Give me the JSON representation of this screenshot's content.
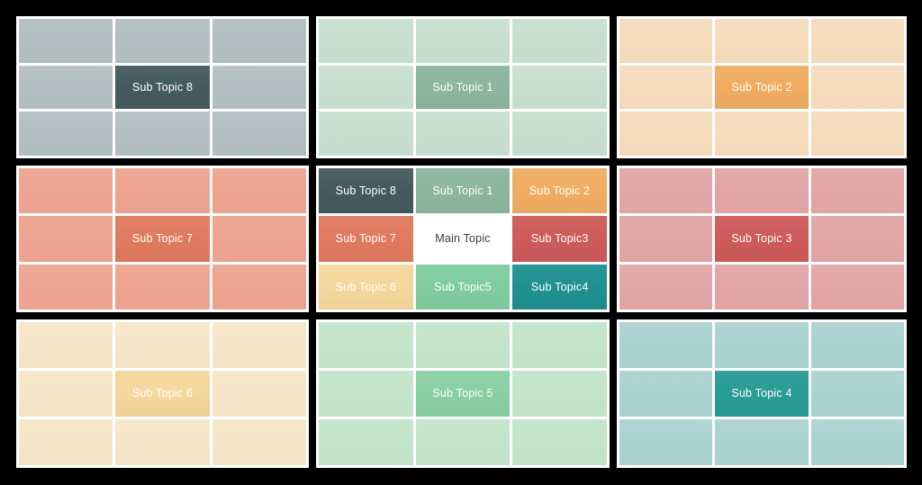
{
  "diagram": {
    "type": "mandala-chart",
    "title": "Main Topic",
    "background_color": "#000000",
    "gridline_color": "#ffffff",
    "main_topic_text_color": "#3b3b3b",
    "sub_topic_text_color": "#ffffff"
  },
  "center_block": {
    "name": "center-block",
    "cells": [
      {
        "label": "Sub Topic 8",
        "color": "#455a5f",
        "role": "core"
      },
      {
        "label": "Sub Topic 1",
        "color": "#8cb69d",
        "role": "core"
      },
      {
        "label": "Sub Topic 2",
        "color": "#f0ad62",
        "role": "core"
      },
      {
        "label": "Sub Topic 7",
        "color": "#e07a5f",
        "role": "core"
      },
      {
        "label": "Main Topic",
        "color": "#ffffff",
        "role": "main"
      },
      {
        "label": "Sub Topic3",
        "color": "#cd5b5a",
        "role": "core"
      },
      {
        "label": "Sub Topic 6",
        "color": "#f4d79b",
        "role": "core"
      },
      {
        "label": "Sub Topic5",
        "color": "#7fcc9f",
        "role": "core"
      },
      {
        "label": "Sub Topic4",
        "color": "#1f9090",
        "role": "core"
      }
    ]
  },
  "outer_blocks": [
    {
      "name": "block-sub-topic-8",
      "position": "top-left",
      "label": "Sub Topic 8",
      "core_color": "#455a5f",
      "petal_color": "#b3c0c2",
      "cells": [
        "",
        "",
        "",
        "",
        "Sub Topic 8",
        "",
        "",
        "",
        ""
      ]
    },
    {
      "name": "block-sub-topic-1",
      "position": "top-center",
      "label": "Sub Topic 1",
      "core_color": "#8cb69d",
      "petal_color": "#c8dfcf",
      "cells": [
        "",
        "",
        "",
        "",
        "Sub Topic 1",
        "",
        "",
        "",
        ""
      ]
    },
    {
      "name": "block-sub-topic-2",
      "position": "top-right",
      "label": "Sub Topic 2",
      "core_color": "#f0ad62",
      "petal_color": "#f6dbbd",
      "cells": [
        "",
        "",
        "",
        "",
        "Sub Topic 2",
        "",
        "",
        "",
        ""
      ]
    },
    {
      "name": "block-sub-topic-7",
      "position": "middle-left",
      "label": "Sub Topic 7",
      "core_color": "#e07a5f",
      "petal_color": "#eda491",
      "cells": [
        "",
        "",
        "",
        "",
        "Sub Topic 7",
        "",
        "",
        "",
        ""
      ]
    },
    {
      "name": "block-sub-topic-3",
      "position": "middle-right",
      "label": "Sub Topic 3",
      "core_color": "#cd5b5a",
      "petal_color": "#e3a5a5",
      "cells": [
        "",
        "",
        "",
        "",
        "Sub Topic 3",
        "",
        "",
        "",
        ""
      ]
    },
    {
      "name": "block-sub-topic-6",
      "position": "bottom-left",
      "label": "Sub Topic 6",
      "core_color": "#f4d79b",
      "petal_color": "#f7e7c9",
      "cells": [
        "",
        "",
        "",
        "",
        "Sub Topic 6",
        "",
        "",
        "",
        ""
      ]
    },
    {
      "name": "block-sub-topic-5",
      "position": "bottom-center",
      "label": "Sub Topic 5",
      "core_color": "#8acfa4",
      "petal_color": "#c3e5ca",
      "cells": [
        "",
        "",
        "",
        "",
        "Sub Topic 5",
        "",
        "",
        "",
        ""
      ]
    },
    {
      "name": "block-sub-topic-4",
      "position": "bottom-right",
      "label": "Sub Topic 4",
      "core_color": "#2a9b96",
      "petal_color": "#abd2d1",
      "cells": [
        "",
        "",
        "",
        "",
        "Sub Topic 4",
        "",
        "",
        "",
        ""
      ]
    }
  ],
  "block_order": [
    {
      "slot": 0,
      "source": "outer_blocks.0"
    },
    {
      "slot": 1,
      "source": "outer_blocks.1"
    },
    {
      "slot": 2,
      "source": "outer_blocks.2"
    },
    {
      "slot": 3,
      "source": "outer_blocks.3"
    },
    {
      "slot": 4,
      "source": "center_block"
    },
    {
      "slot": 5,
      "source": "outer_blocks.4"
    },
    {
      "slot": 6,
      "source": "outer_blocks.5"
    },
    {
      "slot": 7,
      "source": "outer_blocks.6"
    },
    {
      "slot": 8,
      "source": "outer_blocks.7"
    }
  ]
}
